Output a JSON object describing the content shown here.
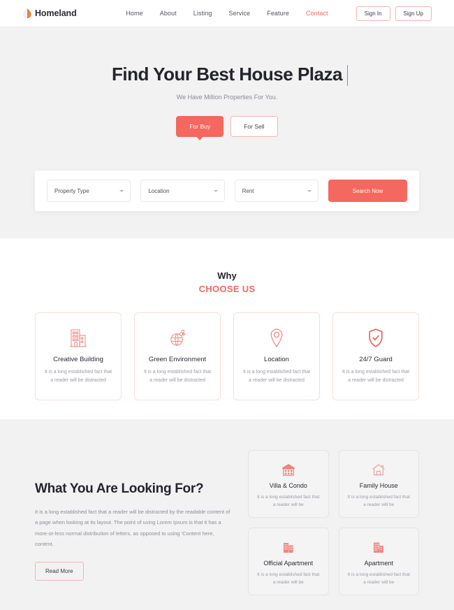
{
  "header": {
    "logo_icon": "flame-drop-icon",
    "logo_text": "Homeland",
    "nav": [
      {
        "label": "Home",
        "active": false
      },
      {
        "label": "About",
        "active": false
      },
      {
        "label": "Listing",
        "active": false
      },
      {
        "label": "Service",
        "active": false
      },
      {
        "label": "Feature",
        "active": false
      },
      {
        "label": "Contact",
        "active": true
      }
    ],
    "sign_in": "Sign In",
    "sign_up": "Sign Up"
  },
  "hero": {
    "title": "Find Your Best House Plaza",
    "subtitle": "We Have Million Properties For You.",
    "toggle_buy": "For Buy",
    "toggle_sell": "For Sell",
    "search": {
      "property_type": "Property Type",
      "location": "Location",
      "rent": "Rent",
      "button": "Search Now"
    }
  },
  "why": {
    "title": "Why",
    "subtitle": "CHOOSE US",
    "cards": [
      {
        "icon": "building-icon",
        "name": "Creative Building",
        "desc": "It is a long established fact that a reader will be distracted"
      },
      {
        "icon": "globe-leaf-icon",
        "name": "Green Environment",
        "desc": "It is a long established fact that a reader will be distracted"
      },
      {
        "icon": "map-pin-icon",
        "name": "Location",
        "desc": "It is a long established fact that a reader will be distracted"
      },
      {
        "icon": "shield-check-icon",
        "name": "24/7 Guard",
        "desc": "It is a long established fact that a reader will be distracted"
      }
    ]
  },
  "looking": {
    "title": "What You Are Looking For?",
    "body": "It is a long established fact that a reader will be distracted by the readable content of a page when looking at its layout. The point of using Lorem Ipsum is that it has a more-or-less normal distribution of letters, as opposed to using 'Content here, content.",
    "read_more": "Read More",
    "cards": [
      {
        "icon": "villa-icon",
        "name": "Villa & Condo",
        "desc": "It is a long established fact that a reader will be"
      },
      {
        "icon": "family-house-icon",
        "name": "Family House",
        "desc": "It is a long established fact that a reader will be"
      },
      {
        "icon": "official-apartment-icon",
        "name": "Official Apartment",
        "desc": "It is a long established fact that a reader will be"
      },
      {
        "icon": "apartment-icon",
        "name": "Apartment",
        "desc": "It is a long established fact that a reader will be"
      }
    ]
  },
  "colors": {
    "accent": "#f4685f",
    "logo_orange": "#e8843c",
    "dark_text": "#24242c",
    "muted_text": "#8d8d97",
    "section_gray": "#f2f2f3"
  }
}
